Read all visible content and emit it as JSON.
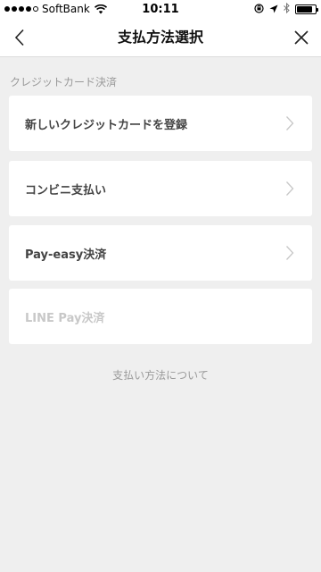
{
  "status_bar": {
    "carrier": "SoftBank",
    "time": "10:11",
    "signal_bars_filled": 4,
    "signal_bars_total": 5,
    "battery_level": 0.85
  },
  "nav": {
    "title": "支払方法選択",
    "back_icon": "chevron-left-icon",
    "close_icon": "close-icon"
  },
  "section": {
    "header": "クレジットカード決済"
  },
  "payment_options": [
    {
      "label": "新しいクレジットカードを登録",
      "enabled": true
    },
    {
      "label": "コンビニ支払い",
      "enabled": true
    },
    {
      "label": "Pay-easy決済",
      "enabled": true
    },
    {
      "label": "LINE Pay決済",
      "enabled": false
    }
  ],
  "footer": {
    "link": "支払い方法について"
  },
  "colors": {
    "background": "#efefef",
    "card": "#ffffff",
    "text": "#444444",
    "muted": "#999999",
    "disabled": "#c8c8c8"
  }
}
